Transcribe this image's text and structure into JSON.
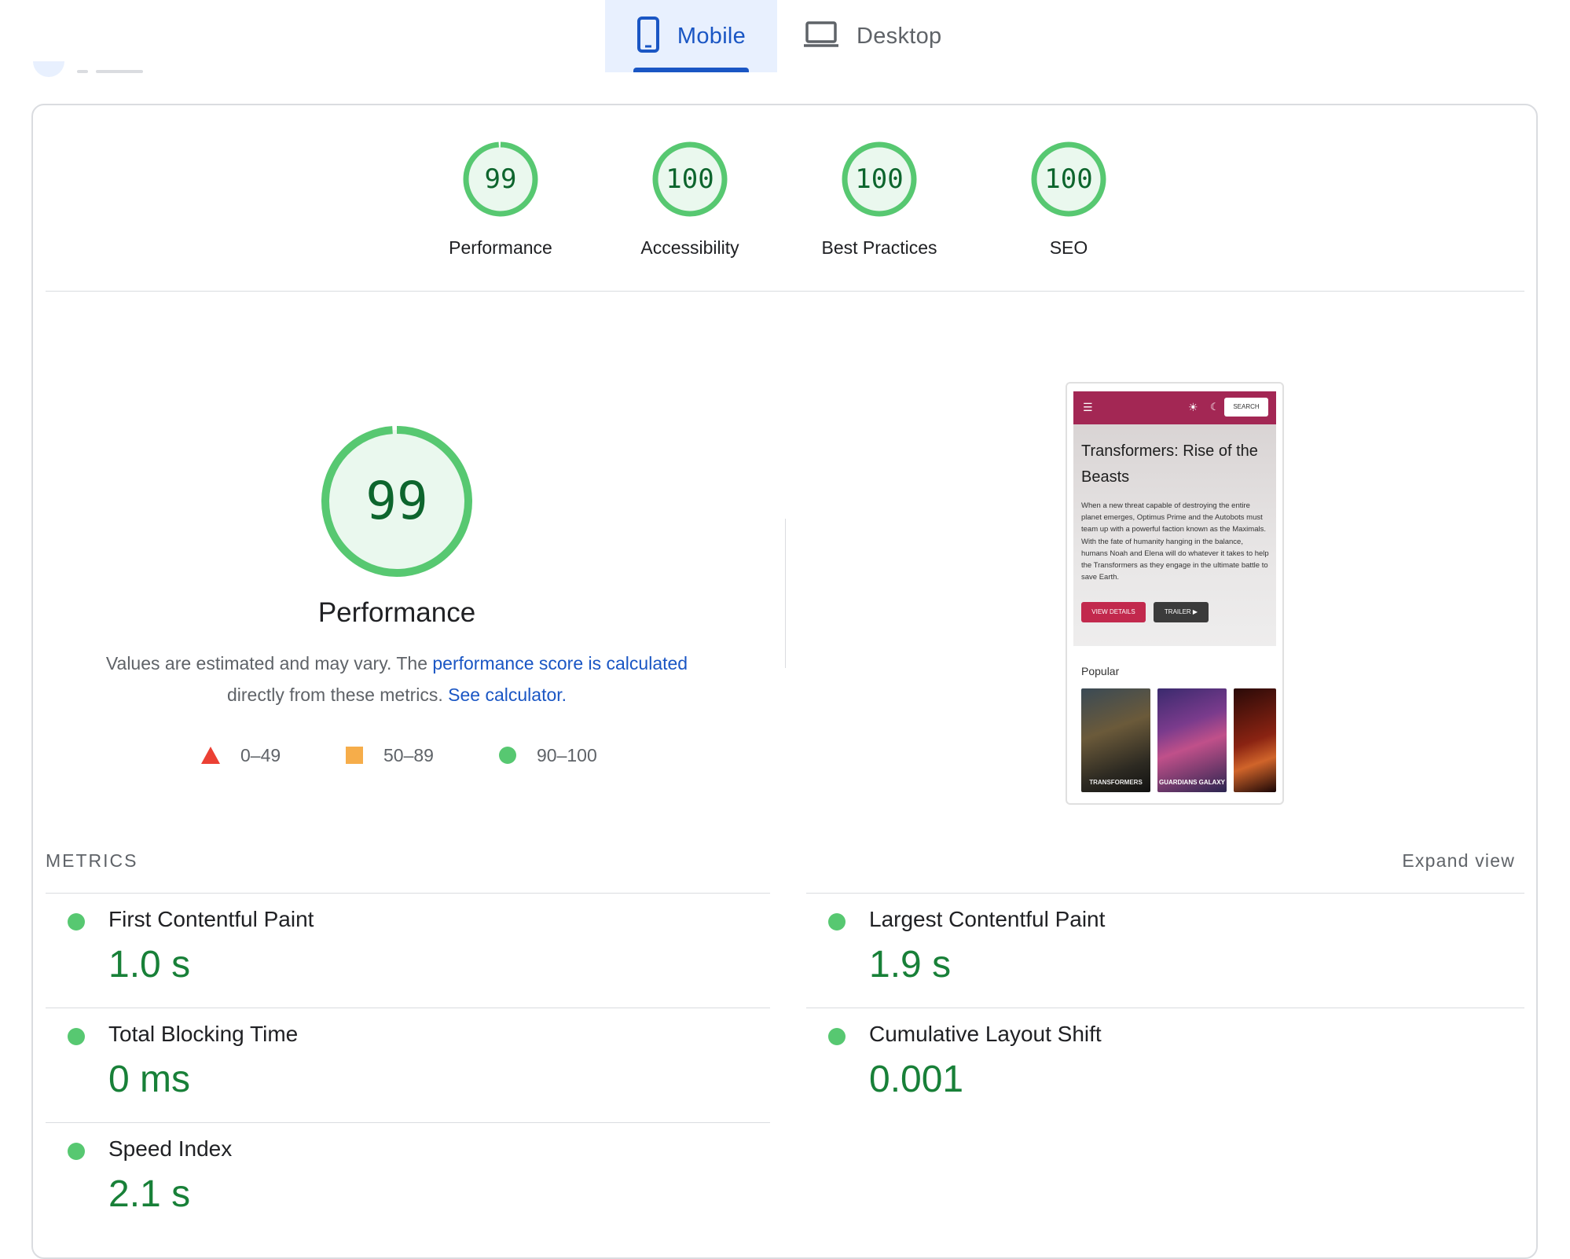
{
  "tabs": [
    {
      "label": "Mobile",
      "selected": true,
      "icon": "smartphone-icon"
    },
    {
      "label": "Desktop",
      "selected": false,
      "icon": "laptop-icon"
    }
  ],
  "colors": {
    "accent": "#1a56c4",
    "pass": "#57c871",
    "pass_text": "#188038",
    "average": "#f6ad4a",
    "fail": "#eb4034"
  },
  "categories": [
    {
      "label": "Performance",
      "score": "99"
    },
    {
      "label": "Accessibility",
      "score": "100"
    },
    {
      "label": "Best Practices",
      "score": "100"
    },
    {
      "label": "SEO",
      "score": "100"
    }
  ],
  "performance": {
    "score": "99",
    "title": "Performance",
    "desc_prefix": "Values are estimated and may vary. The ",
    "desc_link": "performance score is calculated",
    "desc_mid": "directly from these metrics. ",
    "desc_link2": "See calculator.",
    "legend": [
      {
        "range": "0–49",
        "shape": "triangle"
      },
      {
        "range": "50–89",
        "shape": "square"
      },
      {
        "range": "90–100",
        "shape": "circle"
      }
    ]
  },
  "screenshot": {
    "search_label": "SEARCH",
    "title": "Transformers: Rise of the Beasts",
    "description": "When a new threat capable of destroying the entire planet emerges, Optimus Prime and the Autobots must team up with a powerful faction known as the Maximals. With the fate of humanity hanging in the balance, humans Noah and Elena will do whatever it takes to help the Transformers as they engage in the ultimate battle to save Earth.",
    "btn_details": "VIEW DETAILS",
    "btn_trailer": "TRAILER ▶",
    "popular_label": "Popular",
    "poster1_caption": "TRANSFORMERS",
    "poster2_caption": "GUARDIANS GALAXY"
  },
  "metrics": {
    "heading": "METRICS",
    "expand_label": "Expand view",
    "items": [
      {
        "title": "First Contentful Paint",
        "value": "1.0 s"
      },
      {
        "title": "Largest Contentful Paint",
        "value": "1.9 s"
      },
      {
        "title": "Total Blocking Time",
        "value": "0 ms"
      },
      {
        "title": "Cumulative Layout Shift",
        "value": "0.001"
      },
      {
        "title": "Speed Index",
        "value": "2.1 s"
      }
    ]
  }
}
